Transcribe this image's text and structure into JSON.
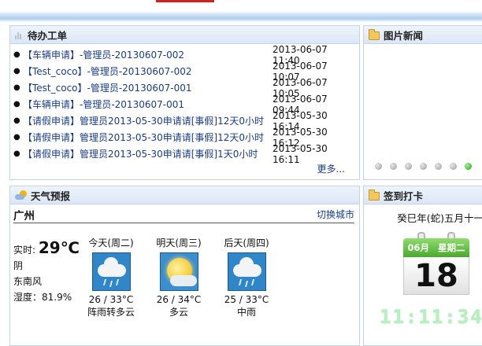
{
  "todo": {
    "title": "待办工单",
    "items": [
      {
        "title": "【车辆申请】-管理员-20130607-002",
        "time": "2013-06-07 11:40"
      },
      {
        "title": "【Test_coco】-管理员-20130607-002",
        "time": "2013-06-07 10:07"
      },
      {
        "title": "【Test_coco】-管理员-20130607-001",
        "time": "2013-06-07 10:05"
      },
      {
        "title": "【车辆申请】-管理员-20130607-001",
        "time": "2013-06-07 09:44"
      },
      {
        "title": "【请假申请】管理员2013-05-30申请请[事假]12天0小时",
        "time": "2013-05-30 16:14"
      },
      {
        "title": "【请假申请】管理员2013-05-30申请请[事假]12天0小时",
        "time": "2013-05-30 16:12"
      },
      {
        "title": "【请假申请】管理员2013-05-30申请请[事假]1天0小时",
        "time": "2013-05-30 16:11"
      }
    ],
    "more": "更多..."
  },
  "photo_news": {
    "title": "图片新闻",
    "dots_total": 7,
    "active_dot": 7
  },
  "weather": {
    "title": "天气预报",
    "city": "广州",
    "switch_city": "切换城市",
    "now_label": "实时:",
    "now_temp": "29℃",
    "now_condition": "阴",
    "now_wind": "东南风",
    "now_humidity": "湿度：81.9%",
    "days": [
      {
        "label": "今天(周二)",
        "temp": "26 / 33°C",
        "desc": "阵雨转多云",
        "icon": "rain-cloud-icon"
      },
      {
        "label": "明天(周三)",
        "temp": "26 / 34°C",
        "desc": "多云",
        "icon": "sun-cloud-icon"
      },
      {
        "label": "后天(周四)",
        "temp": "25 / 33°C",
        "desc": "中雨",
        "icon": "rain-cloud-icon"
      }
    ]
  },
  "checkin": {
    "title": "签到打卡",
    "lunar": "癸巳年(蛇)五月十一",
    "month": "06月",
    "weekday": "星期二",
    "day": "18",
    "clock": "11:11:34"
  }
}
